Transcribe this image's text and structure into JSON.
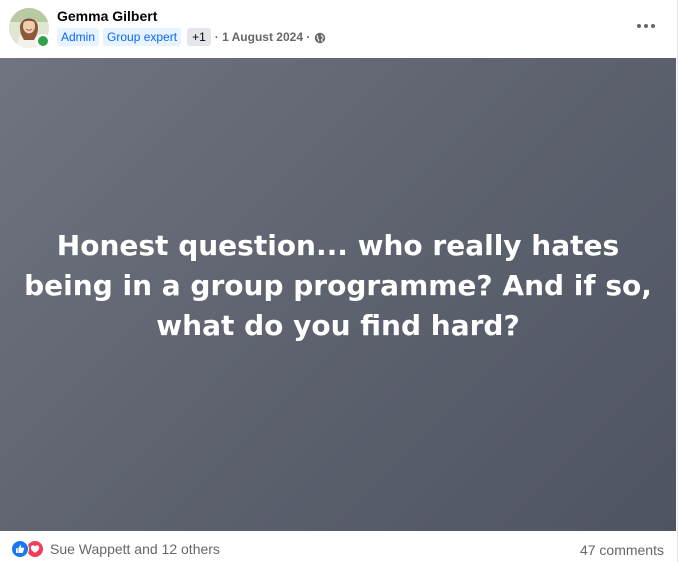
{
  "post": {
    "author": "Gemma Gilbert",
    "badges": [
      "Admin",
      "Group expert"
    ],
    "badge_more": "+1",
    "date": "· 1 August 2024 ·",
    "text": "Honest question... who really hates being in a group programme? And if so, what do you find hard?",
    "background_gradient": [
      "#6f7480",
      "#4f5463"
    ]
  },
  "footer": {
    "reactions_label": "Sue Wappett and 12 others",
    "reaction_icons": [
      "like-icon",
      "love-icon"
    ],
    "comments_label": "47 comments"
  },
  "colors": {
    "badge_blue": "#0866ff",
    "badge_bg": "#e7f3ff",
    "online_green": "#31a24c",
    "like_blue": "#1877f2",
    "love_red": "#f33e58"
  }
}
